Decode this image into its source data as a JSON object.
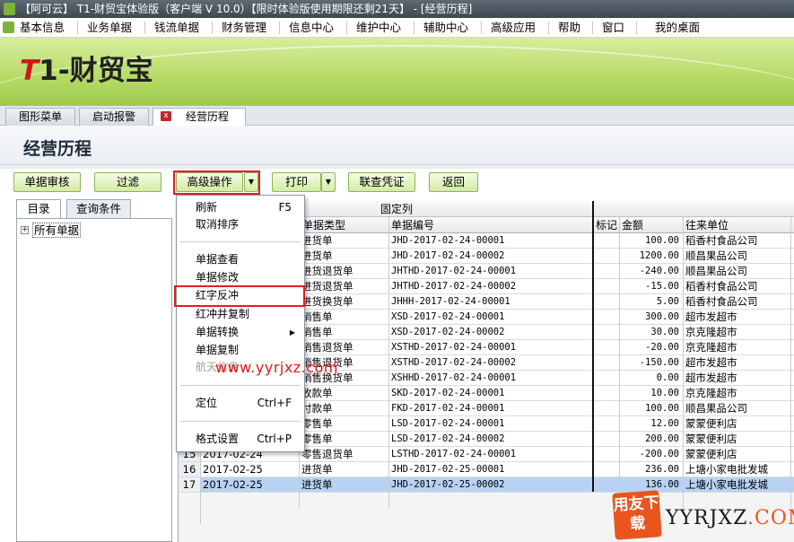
{
  "window": {
    "title": "【阿可云】 T1-财贸宝体验版（客户端 V 10.0）【限时体验版使用期限还剩21天】 - [经营历程]"
  },
  "menu": {
    "items": [
      "基本信息",
      "业务单据",
      "钱流单据",
      "财务管理",
      "信息中心",
      "维护中心",
      "辅助中心",
      "高级应用",
      "帮助",
      "窗口",
      "我的桌面"
    ]
  },
  "banner": {
    "logo_t": "T",
    "logo_rest": "1-财贸宝"
  },
  "tabs": [
    {
      "label": "图形菜单"
    },
    {
      "label": "启动报警"
    },
    {
      "label": "经营历程",
      "close": "x"
    }
  ],
  "page": {
    "title": "经营历程"
  },
  "toolbar": {
    "audit": "单据审核",
    "filter": "过滤",
    "advanced": "高级操作",
    "print": "打印",
    "voucher": "联查凭证",
    "back": "返回",
    "arrow": "▼"
  },
  "left": {
    "tab_dir": "目录",
    "tab_query": "查询条件",
    "tree_expand": "+",
    "tree_root": "所有单据"
  },
  "grid": {
    "fixed_label": "固定列",
    "headers": {
      "type": "单据类型",
      "code": "单据编号",
      "mark": "标记",
      "amount": "金额",
      "party": "往来单位"
    },
    "rows": [
      {
        "n": "",
        "date": "",
        "type": "进货单",
        "code": "JHD-2017-02-24-00001",
        "amount": "100.00",
        "party": "稻香村食品公司"
      },
      {
        "n": "",
        "date": "",
        "type": "进货单",
        "code": "JHD-2017-02-24-00002",
        "amount": "1200.00",
        "party": "顺昌果品公司"
      },
      {
        "n": "",
        "date": "",
        "type": "进货退货单",
        "code": "JHTHD-2017-02-24-00001",
        "amount": "-240.00",
        "party": "顺昌果品公司"
      },
      {
        "n": "",
        "date": "",
        "type": "进货退货单",
        "code": "JHTHD-2017-02-24-00002",
        "amount": "-15.00",
        "party": "稻香村食品公司"
      },
      {
        "n": "",
        "date": "",
        "type": "进货换货单",
        "code": "JHHH-2017-02-24-00001",
        "amount": "5.00",
        "party": "稻香村食品公司"
      },
      {
        "n": "",
        "date": "",
        "type": "销售单",
        "code": "XSD-2017-02-24-00001",
        "amount": "300.00",
        "party": "超市发超市"
      },
      {
        "n": "",
        "date": "",
        "type": "销售单",
        "code": "XSD-2017-02-24-00002",
        "amount": "30.00",
        "party": "京克隆超市"
      },
      {
        "n": "",
        "date": "",
        "type": "销售退货单",
        "code": "XSTHD-2017-02-24-00001",
        "amount": "-20.00",
        "party": "京克隆超市"
      },
      {
        "n": "",
        "date": "",
        "type": "销售退货单",
        "code": "XSTHD-2017-02-24-00002",
        "amount": "-150.00",
        "party": "超市发超市"
      },
      {
        "n": "",
        "date": "",
        "type": "销售换货单",
        "code": "XSHHD-2017-02-24-00001",
        "amount": "0.00",
        "party": "超市发超市"
      },
      {
        "n": "",
        "date": "",
        "type": "收款单",
        "code": "SKD-2017-02-24-00001",
        "amount": "10.00",
        "party": "京克隆超市"
      },
      {
        "n": "",
        "date": "",
        "type": "付款单",
        "code": "FKD-2017-02-24-00001",
        "amount": "100.00",
        "party": "顺昌果品公司"
      },
      {
        "n": "",
        "date": "",
        "type": "零售单",
        "code": "LSD-2017-02-24-00001",
        "amount": "12.00",
        "party": "蒙蒙便利店"
      },
      {
        "n": "",
        "date": "",
        "type": "零售单",
        "code": "LSD-2017-02-24-00002",
        "amount": "200.00",
        "party": "蒙蒙便利店"
      },
      {
        "n": "15",
        "date": "2017-02-24",
        "type": "零售退货单",
        "code": "LSTHD-2017-02-24-00001",
        "amount": "-200.00",
        "party": "蒙蒙便利店"
      },
      {
        "n": "16",
        "date": "2017-02-25",
        "type": "进货单",
        "code": "JHD-2017-02-25-00001",
        "amount": "236.00",
        "party": "上塘小家电批发城"
      },
      {
        "n": "17",
        "date": "2017-02-25",
        "type": "进货单",
        "code": "JHD-2017-02-25-00002",
        "amount": "136.00",
        "party": "上塘小家电批发城"
      }
    ]
  },
  "context_menu": {
    "refresh": "刷新",
    "refresh_sc": "F5",
    "cancel_sort": "取消排序",
    "view": "单据查看",
    "edit": "单据修改",
    "red_reverse": "红字反冲",
    "red_copy": "红冲并复制",
    "convert": "单据转换",
    "copy": "单据复制",
    "hangtian": "航天信息",
    "locate": "定位",
    "locate_sc": "Ctrl+F",
    "format": "格式设置",
    "format_sc": "Ctrl+P",
    "submenu_arrow": "▶"
  },
  "watermark": {
    "url": "www.yyrjxz.com",
    "logo": "用友下载",
    "site_a": "YYRJXZ",
    "site_b": ".COM"
  },
  "colors": {
    "banner": "#b9dc6a",
    "button": "#d4eba4",
    "highlight_box": "#e02020",
    "selected_row": "#b8d2f4"
  }
}
